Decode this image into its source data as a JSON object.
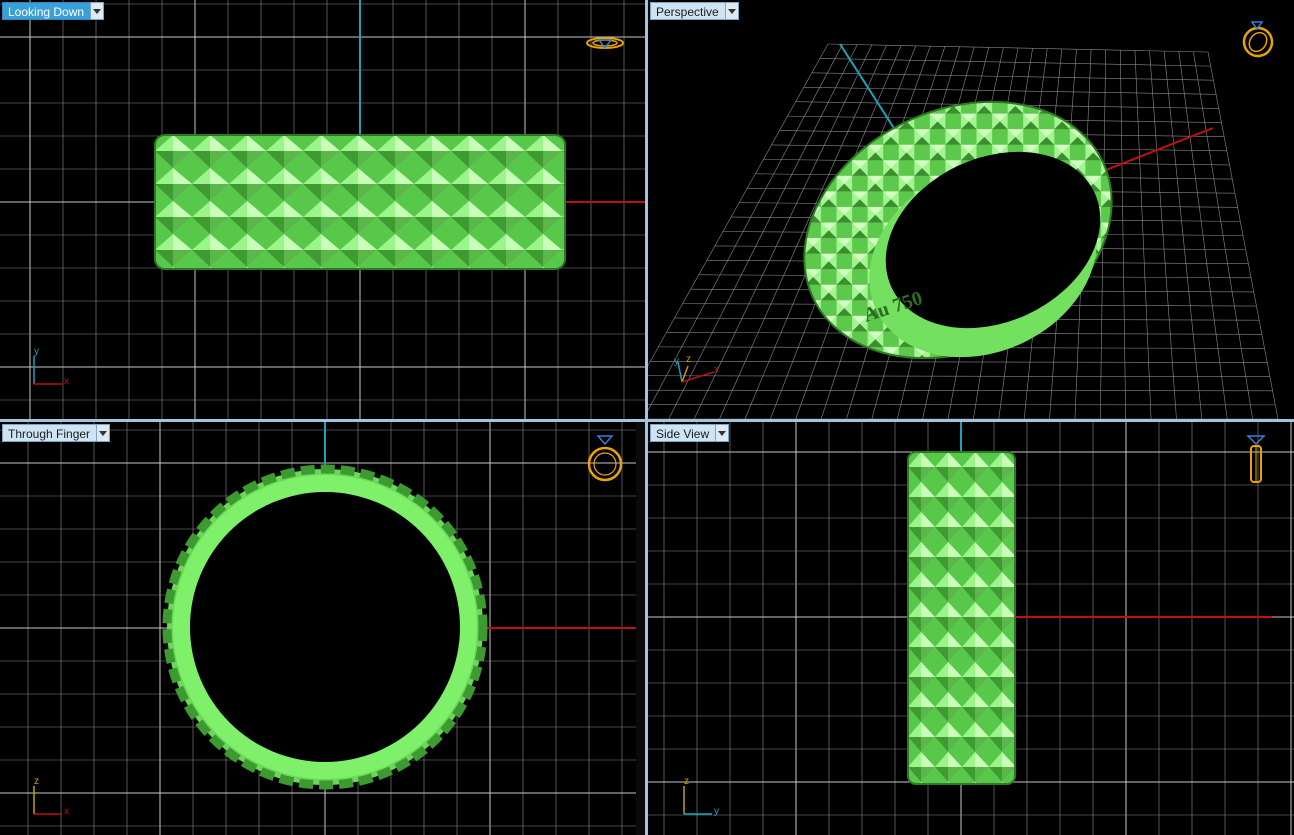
{
  "viewports": {
    "top_left": {
      "label": "Looking Down",
      "active": true,
      "axes": [
        "y",
        "x"
      ]
    },
    "top_right": {
      "label": "Perspective",
      "active": false,
      "axes": [
        "y",
        "z",
        "x"
      ],
      "engraving": "Au 750"
    },
    "bottom_left": {
      "label": "Through Finger",
      "active": false,
      "axes": [
        "z",
        "x"
      ]
    },
    "bottom_right": {
      "label": "Side View",
      "active": false,
      "axes": [
        "z",
        "y"
      ]
    }
  },
  "colors": {
    "grid_line": "#8a8a8a",
    "grid_bright": "#c8c8c8",
    "axis_x": "#c01010",
    "axis_y": "#1aa3b8",
    "model_green": "#7ef06a",
    "model_dark": "#2e7a22",
    "gizmo_orange": "#e8a400",
    "gizmo_blue": "#3a7fd8",
    "separator": "#9fc6dd"
  },
  "icons": [
    "ring-top-icon",
    "ring-perspective-icon",
    "ring-front-icon",
    "ring-side-icon"
  ]
}
